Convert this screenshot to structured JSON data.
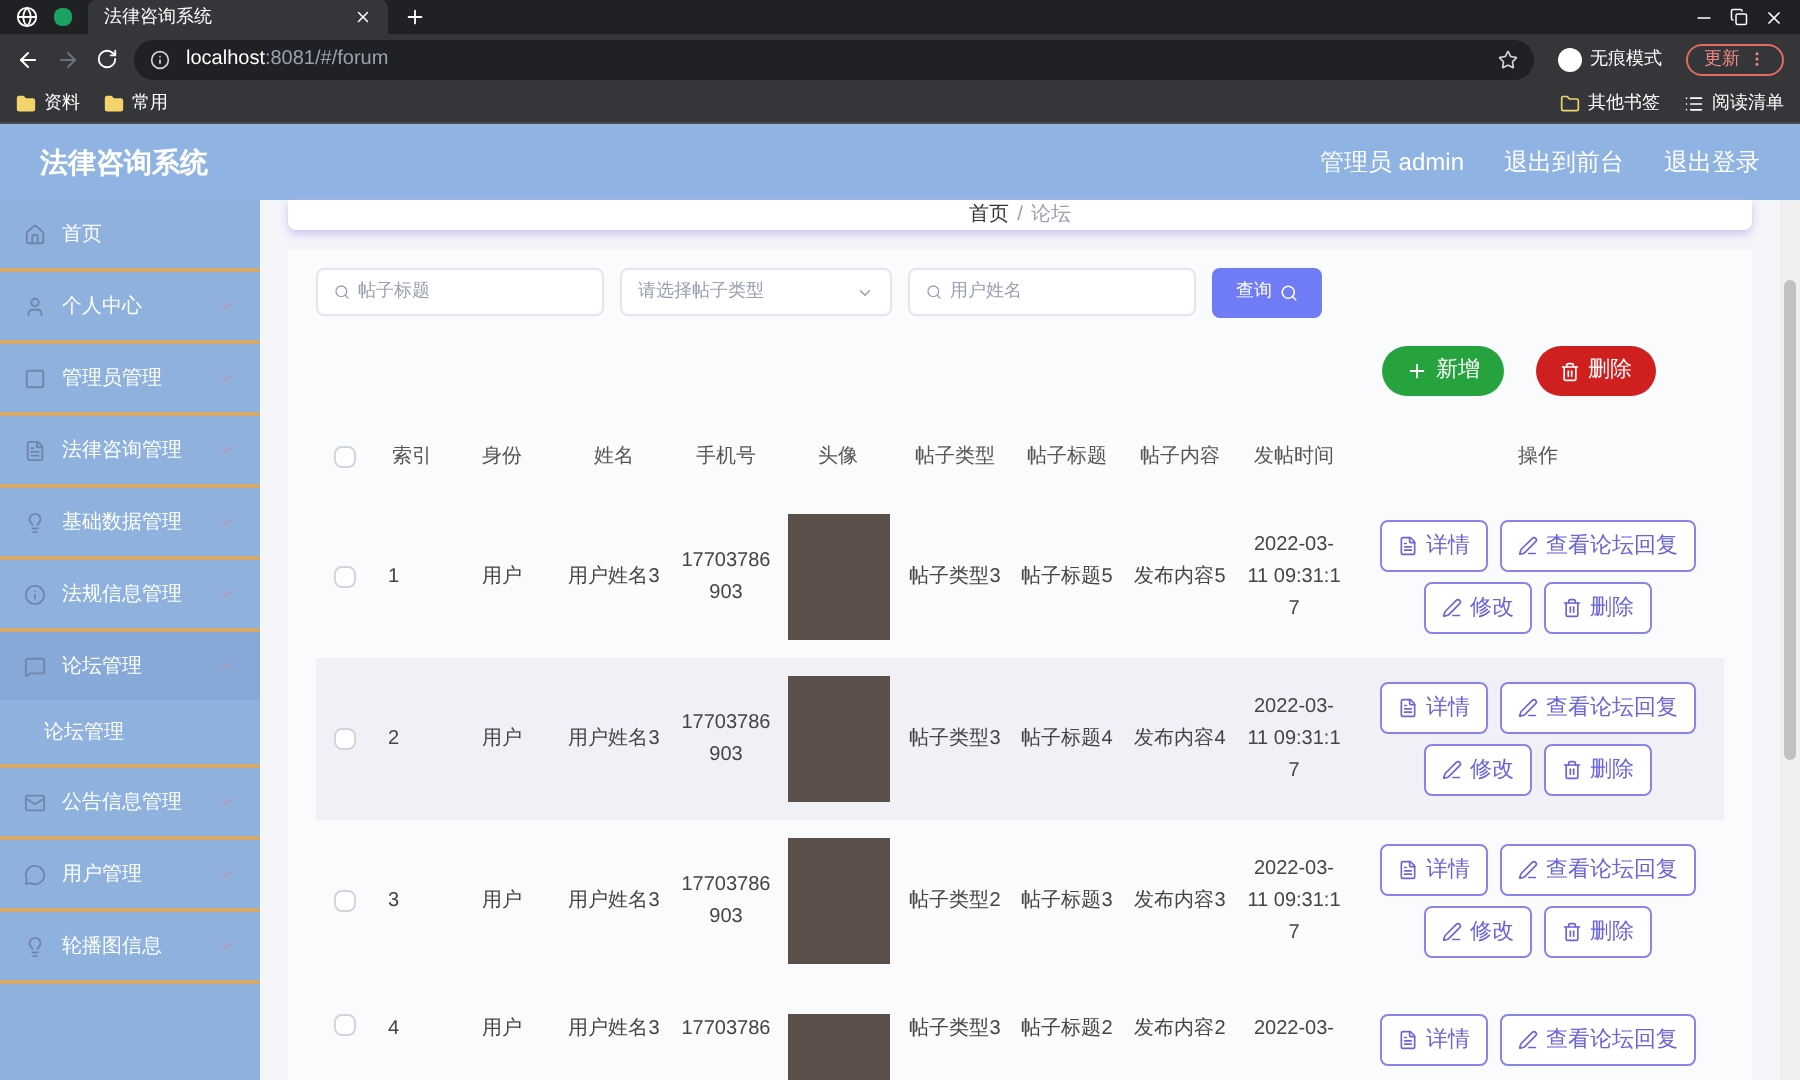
{
  "browser": {
    "tabs": [
      {
        "title": "法律咨询系统",
        "selected": true
      }
    ],
    "url_host": "localhost",
    "url_rest": ":8081/#/forum",
    "profile": "无痕模式",
    "update": "更新",
    "bookmarks": [
      "资料",
      "常用"
    ],
    "bookmarks_right": [
      "其他书签",
      "阅读清单"
    ]
  },
  "header": {
    "title": "法律咨询系统",
    "links": [
      "管理员 admin",
      "退出到前台",
      "退出登录"
    ]
  },
  "sidebar": {
    "items": [
      {
        "label": "首页",
        "kind": "link"
      },
      {
        "label": "个人中心",
        "kind": "group",
        "expanded": false
      },
      {
        "label": "管理员管理",
        "kind": "group",
        "expanded": false
      },
      {
        "label": "法律咨询管理",
        "kind": "group",
        "expanded": false
      },
      {
        "label": "基础数据管理",
        "kind": "group",
        "expanded": false
      },
      {
        "label": "法规信息管理",
        "kind": "group",
        "expanded": false
      },
      {
        "label": "论坛管理",
        "kind": "group",
        "expanded": true,
        "children": [
          {
            "label": "论坛管理"
          }
        ]
      },
      {
        "label": "公告信息管理",
        "kind": "group",
        "expanded": false
      },
      {
        "label": "用户管理",
        "kind": "group",
        "expanded": false
      },
      {
        "label": "轮播图信息",
        "kind": "group",
        "expanded": false
      }
    ]
  },
  "breadcrumb": [
    "首页",
    "/",
    "论坛"
  ],
  "search": {
    "title_placeholder": "帖子标题",
    "type_placeholder": "请选择帖子类型",
    "name_placeholder": "用户姓名",
    "button": "查询"
  },
  "actions": {
    "add": "新增",
    "delete": "删除"
  },
  "table": {
    "all_checked": false,
    "columns": [
      "索引",
      "身份",
      "姓名",
      "手机号",
      "头像",
      "帖子类型",
      "帖子标题",
      "帖子内容",
      "发帖时间",
      "操作"
    ],
    "rows": [
      {
        "index": "1",
        "role": "用户",
        "name": "用户姓名3",
        "phone": [
          "17703786",
          "903"
        ],
        "type": "帖子类型3",
        "title": "帖子标题5",
        "content": "发布内容5",
        "time": [
          "2022-03-",
          "11 09:31:1",
          "7"
        ],
        "checked": false,
        "buttons": [
          "详情",
          "查看论坛回复",
          "修改",
          "删除"
        ]
      },
      {
        "index": "2",
        "role": "用户",
        "name": "用户姓名3",
        "phone": [
          "17703786",
          "903"
        ],
        "type": "帖子类型3",
        "title": "帖子标题4",
        "content": "发布内容4",
        "time": [
          "2022-03-",
          "11 09:31:1",
          "7"
        ],
        "checked": false,
        "buttons": [
          "详情",
          "查看论坛回复",
          "修改",
          "删除"
        ]
      },
      {
        "index": "3",
        "role": "用户",
        "name": "用户姓名3",
        "phone": [
          "17703786",
          "903"
        ],
        "type": "帖子类型2",
        "title": "帖子标题3",
        "content": "发布内容3",
        "time": [
          "2022-03-",
          "11 09:31:1",
          "7"
        ],
        "checked": false,
        "buttons": [
          "详情",
          "查看论坛回复",
          "修改",
          "删除"
        ]
      },
      {
        "index": "4",
        "role": "用户",
        "name": "用户姓名3",
        "phone": [
          "17703786"
        ],
        "type": "帖子类型3",
        "title": "帖子标题2",
        "content": "发布内容2",
        "time": [
          "2022-03-"
        ],
        "checked": false,
        "buttons": [
          "详情",
          "查看论坛回复"
        ]
      }
    ]
  }
}
